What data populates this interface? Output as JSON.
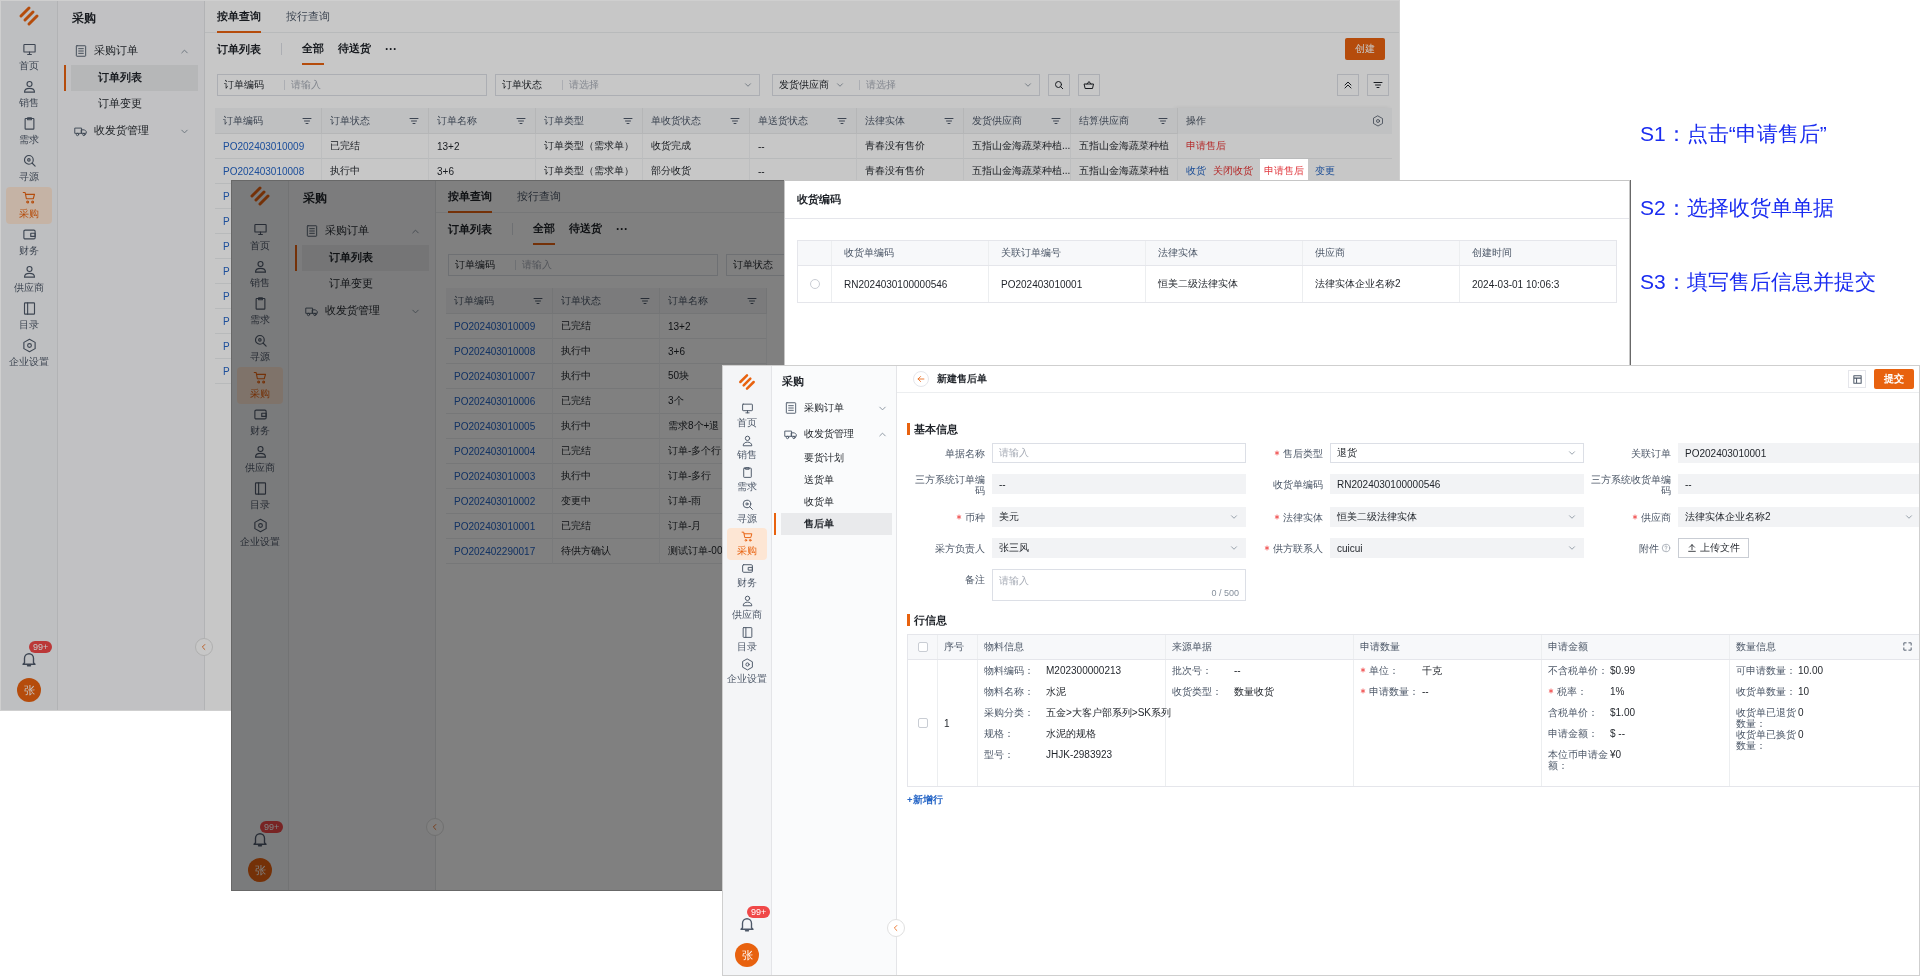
{
  "back_window": {
    "app_title": "采购",
    "nav": [
      {
        "label": "首页",
        "selected": false
      },
      {
        "label": "销售",
        "selected": false
      },
      {
        "label": "需求",
        "selected": false
      },
      {
        "label": "寻源",
        "selected": false
      },
      {
        "label": "采购",
        "selected": true
      },
      {
        "label": "财务",
        "selected": false
      },
      {
        "label": "供应商",
        "selected": false
      },
      {
        "label": "目录",
        "selected": false
      },
      {
        "label": "企业设置",
        "selected": false
      }
    ],
    "notification_badge": "99+",
    "avatar": "张",
    "sidebar": [
      {
        "label": "采购订单",
        "expanded": true,
        "children": [
          {
            "label": "订单列表",
            "selected": true
          },
          {
            "label": "订单变更",
            "selected": false
          }
        ]
      },
      {
        "label": "收发货管理",
        "expanded": false
      }
    ],
    "tabs": [
      {
        "label": "按单查询",
        "selected": true
      },
      {
        "label": "按行查询",
        "selected": false
      }
    ],
    "list_title": "订单列表",
    "sub_tabs": [
      {
        "label": "全部",
        "selected": true
      },
      {
        "label": "待送货",
        "selected": false
      }
    ],
    "more": "···",
    "create_button": "创建",
    "filters": [
      {
        "label": "订单编码",
        "placeholder": "请输入",
        "kind": "input"
      },
      {
        "label": "订单状态",
        "placeholder": "请选择",
        "kind": "select"
      },
      {
        "label": "发货供应商",
        "placeholder": "请选择",
        "kind": "dropdown-select"
      }
    ],
    "table": {
      "columns": [
        "订单编码",
        "订单状态",
        "订单名称",
        "订单类型",
        "单收货状态",
        "单送货状态",
        "法律实体",
        "发货供应商",
        "结算供应商"
      ],
      "actions_column": "操作",
      "rows": [
        {
          "cells": [
            "PO202403010009",
            "已完结",
            "13+2",
            "订单类型（需求单）",
            "收货完成",
            "--",
            "青春没有售价",
            "五指山金海蔬菜种植...",
            "五指山金海蔬菜种植"
          ],
          "actions": [
            {
              "label": "申请售后",
              "kind": "danger",
              "highlighted": false
            }
          ]
        },
        {
          "cells": [
            "PO202403010008",
            "执行中",
            "3+6",
            "订单类型（需求单）",
            "部分收货",
            "--",
            "青春没有售价",
            "五指山金海蔬菜种植...",
            "五指山金海蔬菜种植"
          ],
          "actions": [
            {
              "label": "收货",
              "kind": "link",
              "highlighted": false
            },
            {
              "label": "关闭收货",
              "kind": "danger",
              "highlighted": false
            },
            {
              "label": "申请售后",
              "kind": "danger",
              "highlighted": true
            },
            {
              "label": "变更",
              "kind": "link",
              "highlighted": false
            }
          ]
        },
        {
          "cells": [
            "P"
          ]
        },
        {
          "cells": [
            "P"
          ]
        },
        {
          "cells": [
            "P"
          ]
        },
        {
          "cells": [
            "P"
          ]
        },
        {
          "cells": [
            "P"
          ]
        },
        {
          "cells": [
            "P"
          ]
        },
        {
          "cells": [
            "P"
          ]
        },
        {
          "cells": [
            "P"
          ]
        }
      ]
    }
  },
  "middle_window": {
    "app_title": "采购",
    "nav": [
      {
        "label": "首页",
        "selected": false
      },
      {
        "label": "销售",
        "selected": false
      },
      {
        "label": "需求",
        "selected": false
      },
      {
        "label": "寻源",
        "selected": false
      },
      {
        "label": "采购",
        "selected": true
      },
      {
        "label": "财务",
        "selected": false
      },
      {
        "label": "供应商",
        "selected": false
      },
      {
        "label": "目录",
        "selected": false
      },
      {
        "label": "企业设置",
        "selected": false
      }
    ],
    "notification_badge": "99+",
    "avatar": "张",
    "sidebar": [
      {
        "label": "采购订单",
        "expanded": true,
        "children": [
          {
            "label": "订单列表",
            "selected": true
          },
          {
            "label": "订单变更",
            "selected": false
          }
        ]
      },
      {
        "label": "收发货管理",
        "expanded": false
      }
    ],
    "tabs": [
      {
        "label": "按单查询",
        "selected": true
      },
      {
        "label": "按行查询",
        "selected": false
      }
    ],
    "list_title": "订单列表",
    "sub_tabs": [
      {
        "label": "全部",
        "selected": true
      },
      {
        "label": "待送货",
        "selected": false
      }
    ],
    "more": "···",
    "filters": [
      {
        "label": "订单编码",
        "placeholder": "请输入",
        "kind": "input"
      },
      {
        "label": "订单状态",
        "kind": "input"
      }
    ],
    "table": {
      "columns": [
        "订单编码",
        "订单状态",
        "订单名称"
      ],
      "rows": [
        {
          "cells": [
            "PO202403010009",
            "已完结",
            "13+2"
          ]
        },
        {
          "cells": [
            "PO202403010008",
            "执行中",
            "3+6"
          ]
        },
        {
          "cells": [
            "PO202403010007",
            "执行中",
            "50块"
          ]
        },
        {
          "cells": [
            "PO202403010006",
            "已完结",
            "3个"
          ]
        },
        {
          "cells": [
            "PO202403010005",
            "执行中",
            "需求8个+退"
          ]
        },
        {
          "cells": [
            "PO202403010004",
            "已完结",
            "订单-多个行"
          ]
        },
        {
          "cells": [
            "PO202403010003",
            "执行中",
            "订单-多行"
          ]
        },
        {
          "cells": [
            "PO202403010002",
            "变更中",
            "订单-雨"
          ]
        },
        {
          "cells": [
            "PO202403010001",
            "已完结",
            "订单-月"
          ]
        },
        {
          "cells": [
            "PO202402290017",
            "待供方确认",
            "测试订单-00"
          ]
        }
      ]
    }
  },
  "popup": {
    "title": "收货编码",
    "columns": [
      "收货单编码",
      "关联订单编号",
      "法律实体",
      "供应商",
      "创建时间"
    ],
    "rows": [
      {
        "selected": false,
        "cells": [
          "RN2024030100000546",
          "PO202403010001",
          "恒美二级法律实体",
          "法律实体企业名称2",
          "2024-03-01 10:06:3"
        ]
      }
    ]
  },
  "front_window": {
    "app_title": "采购",
    "nav": [
      {
        "label": "首页",
        "selected": false
      },
      {
        "label": "销售",
        "selected": false
      },
      {
        "label": "需求",
        "selected": false
      },
      {
        "label": "寻源",
        "selected": false
      },
      {
        "label": "采购",
        "selected": true
      },
      {
        "label": "财务",
        "selected": false
      },
      {
        "label": "供应商",
        "selected": false
      },
      {
        "label": "目录",
        "selected": false
      },
      {
        "label": "企业设置",
        "selected": false
      }
    ],
    "notification_badge": "99+",
    "avatar": "张",
    "sidebar": [
      {
        "label": "采购订单",
        "expanded": false
      },
      {
        "label": "收发货管理",
        "expanded": true,
        "children": [
          {
            "label": "要货计划",
            "selected": false
          },
          {
            "label": "送货单",
            "selected": false
          },
          {
            "label": "收货单",
            "selected": false
          },
          {
            "label": "售后单",
            "selected": true
          }
        ]
      }
    ],
    "page_title": "新建售后单",
    "submit_button": "提交",
    "basic_section": "基本信息",
    "form": [
      {
        "label": "单据名称",
        "required": false,
        "kind": "input",
        "placeholder": "请输入",
        "disabled": false
      },
      {
        "label": "售后类型",
        "required": true,
        "kind": "select",
        "value": "退货",
        "disabled": false
      },
      {
        "label": "关联订单",
        "required": false,
        "kind": "input",
        "value": "PO202403010001",
        "disabled": true
      },
      {
        "label": "三方系统订单编码",
        "required": false,
        "kind": "input",
        "value": "--",
        "disabled": true
      },
      {
        "label": "收货单编码",
        "required": false,
        "kind": "input",
        "value": "RN2024030100000546",
        "disabled": true
      },
      {
        "label": "三方系统收货单编码",
        "required": false,
        "kind": "input",
        "value": "--",
        "disabled": true
      },
      {
        "label": "币种",
        "required": true,
        "kind": "select",
        "value": "美元",
        "disabled": true
      },
      {
        "label": "法律实体",
        "required": true,
        "kind": "select",
        "value": "恒美二级法律实体",
        "disabled": true
      },
      {
        "label": "供应商",
        "required": true,
        "kind": "select",
        "value": "法律实体企业名称2",
        "disabled": true
      },
      {
        "label": "采方负责人",
        "required": false,
        "kind": "select",
        "value": "张三风",
        "disabled": true
      },
      {
        "label": "供方联系人",
        "required": true,
        "kind": "select",
        "value": "cuicui",
        "disabled": true
      },
      {
        "label": "附件",
        "required": false,
        "kind": "upload",
        "button": "上传文件",
        "disabled": false
      },
      {
        "label": "备注",
        "required": false,
        "kind": "textarea",
        "placeholder": "请输入",
        "counter": "0 / 500",
        "disabled": false
      }
    ],
    "lines_section": "行信息",
    "line_table": {
      "all_checked": false,
      "columns": [
        "序号",
        "物料信息",
        "来源单据",
        "申请数量",
        "申请金额",
        "数量信息"
      ],
      "rows": [
        {
          "checked": false,
          "index": "1",
          "groups": [
            [
              {
                "key": "物料编码：",
                "value": "M202300000213",
                "required": false
              },
              {
                "key": "物料名称：",
                "value": "水泥",
                "required": false
              },
              {
                "key": "采购分类：",
                "value": "五金>大客户部系列>SK系列",
                "required": false
              },
              {
                "key": "规格：",
                "value": "水泥的规格",
                "required": false
              },
              {
                "key": "型号：",
                "value": "JHJK-2983923",
                "required": false
              }
            ],
            [
              {
                "key": "批次号：",
                "value": "--",
                "required": false
              },
              {
                "key": "收货类型：",
                "value": "数量收货",
                "required": false
              }
            ],
            [
              {
                "key": "单位：",
                "value": "千克",
                "required": true
              },
              {
                "key": "申请数量：",
                "value": "--",
                "required": true
              }
            ],
            [
              {
                "key": "不含税单价：",
                "value": "$0.99",
                "required": false
              },
              {
                "key": "税率：",
                "value": "1%",
                "required": true
              },
              {
                "key": "含税单价：",
                "value": "$1.00",
                "required": false
              },
              {
                "key": "申请金额：",
                "value": "$ --",
                "required": false
              },
              {
                "key": "本位币申请金额：",
                "value": "¥0",
                "required": false
              }
            ],
            [
              {
                "key": "可申请数量：",
                "value": "10.00",
                "required": false
              },
              {
                "key": "收货单数量：",
                "value": "10",
                "required": false
              },
              {
                "key": "收货单已退货数量：",
                "value": "0",
                "required": false
              },
              {
                "key": "收货单已换货数量：",
                "value": "0",
                "required": false
              }
            ]
          ]
        }
      ]
    },
    "add_row": "+新增行"
  },
  "steps": [
    "S1：点击“申请售后”",
    "S2：选择收货单单据",
    "S3：填写售后信息并提交"
  ]
}
